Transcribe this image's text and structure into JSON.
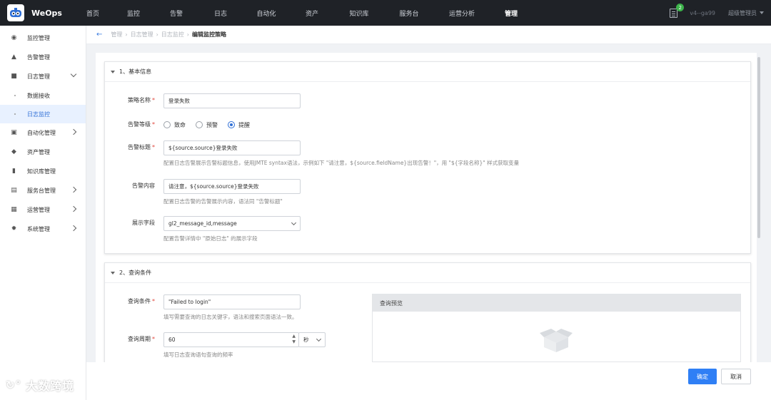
{
  "app": {
    "brand": "WeOps"
  },
  "nav": {
    "items": [
      {
        "label": "首页",
        "active": false
      },
      {
        "label": "监控",
        "active": false
      },
      {
        "label": "告警",
        "active": false
      },
      {
        "label": "日志",
        "active": false
      },
      {
        "label": "自动化",
        "active": false
      },
      {
        "label": "资产",
        "active": false
      },
      {
        "label": "知识库",
        "active": false
      },
      {
        "label": "服务台",
        "active": false
      },
      {
        "label": "运营分析",
        "active": false
      },
      {
        "label": "管理",
        "active": true
      }
    ],
    "notification_count": "2",
    "version": "v4--ga99",
    "user": "超级管理员"
  },
  "sidebar": {
    "items": [
      {
        "label": "监控管理",
        "icon": "camera-icon"
      },
      {
        "label": "告警管理",
        "icon": "alarm-icon"
      },
      {
        "label": "日志管理",
        "icon": "log-icon",
        "expanded": true
      },
      {
        "label": "自动化管理",
        "icon": "automation-icon"
      },
      {
        "label": "资产管理",
        "icon": "layers-icon"
      },
      {
        "label": "知识库管理",
        "icon": "book-icon"
      },
      {
        "label": "服务台管理",
        "icon": "service-icon"
      },
      {
        "label": "运营管理",
        "icon": "operation-icon"
      },
      {
        "label": "系统管理",
        "icon": "settings-icon"
      }
    ],
    "log_sub": [
      {
        "label": "数据接收",
        "active": false
      },
      {
        "label": "日志监控",
        "active": true
      }
    ]
  },
  "breadcrumb": {
    "items": [
      "管理",
      "日志管理",
      "日志监控"
    ],
    "current": "编辑监控策略"
  },
  "section1": {
    "title": "1、基本信息",
    "policy_name": {
      "label": "策略名称",
      "value": "登录失败"
    },
    "alert_level": {
      "label": "告警等级",
      "options": [
        "致命",
        "预警",
        "提醒"
      ],
      "selected": "提醒"
    },
    "alert_title": {
      "label": "告警标题",
      "value": "${source.source}登录失败",
      "hint": "配置日志告警展示告警标题信息，使用JMTE syntax语法，示例如下 \"请注意，${source.fieldName}出现告警！\"，用 \"${字段名称}\" 样式获取变量"
    },
    "alert_content": {
      "label": "告警内容",
      "value": "请注意，${source.source}登录失败",
      "hint": "配置日志告警的告警展示内容，语法同 \"告警标题\""
    },
    "display_fields": {
      "label": "展示字段",
      "value": "gl2_message_id,message",
      "hint": "配置告警详情中 \"原始日志\" 的展示字段"
    }
  },
  "section2": {
    "title": "2、查询条件",
    "query": {
      "label": "查询条件",
      "value": "\"Failed to login\"",
      "hint": "填写需要查询的日志关键字，语法和搜索页面语法一致。"
    },
    "period": {
      "label": "查询周期",
      "value": "60",
      "unit": "秒",
      "hint": "填写日志查询语句查询的频率"
    },
    "preview_title": "查询预览"
  },
  "footer": {
    "confirm": "确定",
    "cancel": "取消"
  },
  "watermark": "大数跨境",
  "colors": {
    "primary": "#2f7ff5",
    "topbar": "#1f2227",
    "required": "#e0443a"
  }
}
